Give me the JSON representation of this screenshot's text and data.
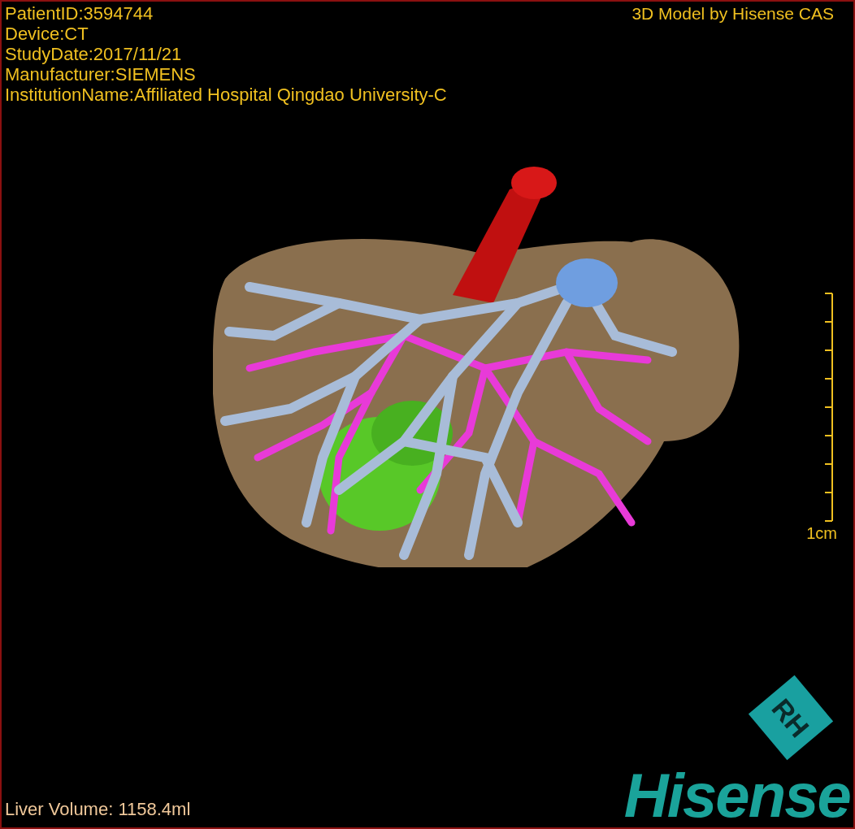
{
  "study_info": [
    "PatientID:3594744",
    "Device:CT",
    "StudyDate:2017/11/21",
    "Manufacturer:SIEMENS",
    "InstitutionName:Affiliated Hospital Qingdao University-C"
  ],
  "title": "3D Model by Hisense CAS",
  "scale_bar": {
    "label": "1cm"
  },
  "liver_volume": "Liver Volume: 1158.4ml",
  "logo": {
    "mark": "RH",
    "wordmark": "Hisense"
  }
}
